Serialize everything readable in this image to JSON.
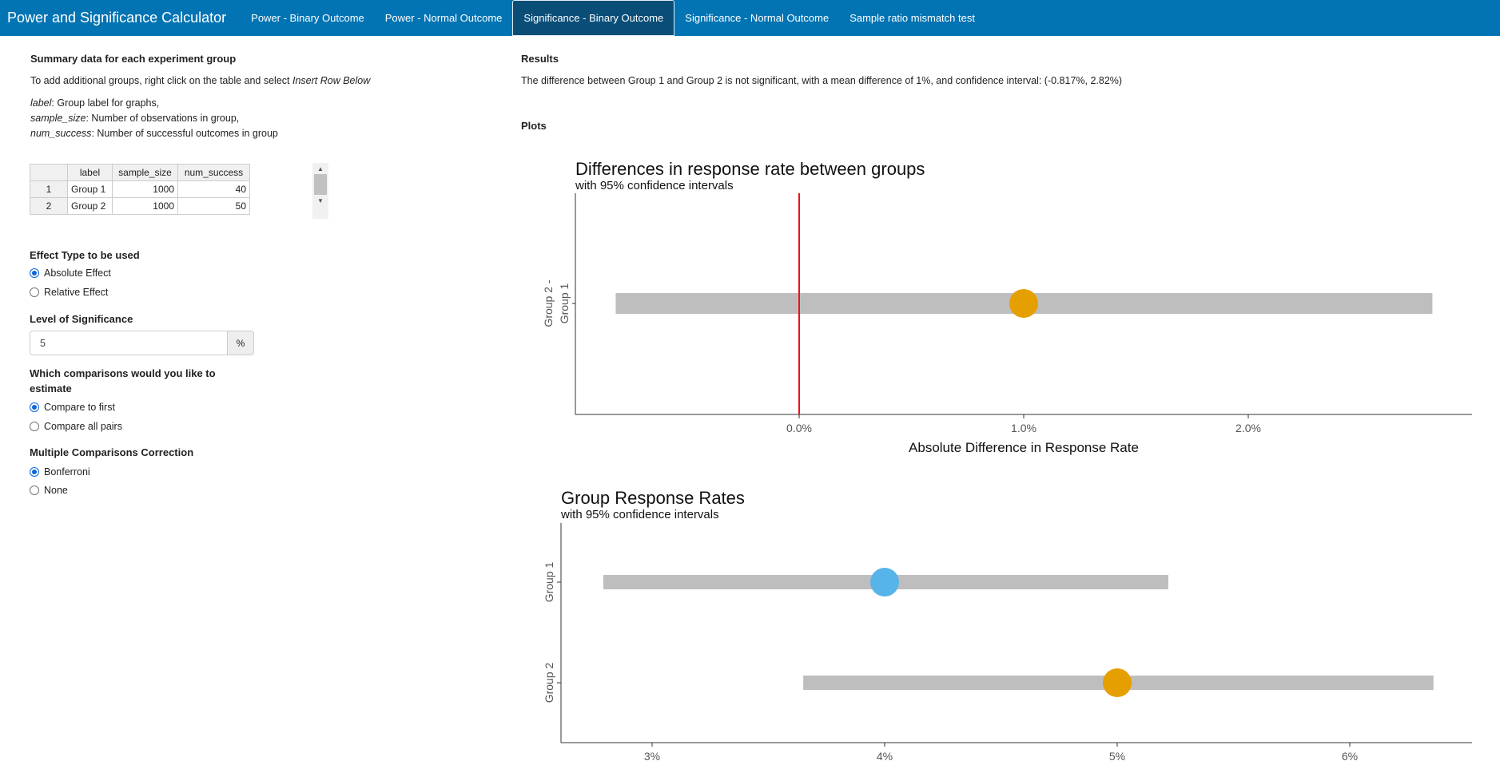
{
  "navbar": {
    "brand": "Power and Significance Calculator",
    "tabs": [
      {
        "label": "Power - Binary Outcome"
      },
      {
        "label": "Power - Normal Outcome"
      },
      {
        "label": "Significance - Binary Outcome",
        "active": true
      },
      {
        "label": "Significance - Normal Outcome"
      },
      {
        "label": "Sample ratio mismatch test"
      }
    ]
  },
  "left": {
    "summary_heading": "Summary data for each experiment group",
    "add_groups_prefix": "To add additional groups, right click on the table and select ",
    "add_groups_italic": "Insert Row Below",
    "desc": [
      {
        "key": "label",
        "text": ": Group label for graphs,"
      },
      {
        "key": "sample_size",
        "text": ": Number of observations in group,"
      },
      {
        "key": "num_success",
        "text": ": Number of successful outcomes in group"
      }
    ],
    "table": {
      "headers": [
        "",
        "label",
        "sample_size",
        "num_success"
      ],
      "rows": [
        {
          "index": "1",
          "label": "Group 1",
          "sample_size": "1000",
          "num_success": "40"
        },
        {
          "index": "2",
          "label": "Group 2",
          "sample_size": "1000",
          "num_success": "50"
        }
      ]
    },
    "effect_type": {
      "label": "Effect Type to be used",
      "options": [
        {
          "label": "Absolute Effect",
          "checked": true
        },
        {
          "label": "Relative Effect",
          "checked": false
        }
      ]
    },
    "significance": {
      "label": "Level of Significance",
      "value": "5",
      "addon": "%"
    },
    "comparisons": {
      "label_line1": "Which comparisons would you like to",
      "label_line2": "estimate",
      "options": [
        {
          "label": "Compare to first",
          "checked": true
        },
        {
          "label": "Compare all pairs",
          "checked": false
        }
      ]
    },
    "correction": {
      "label": "Multiple Comparisons Correction",
      "options": [
        {
          "label": "Bonferroni",
          "checked": true
        },
        {
          "label": "None",
          "checked": false
        }
      ]
    }
  },
  "right": {
    "results_heading": "Results",
    "results_text": "The difference between Group 1 and Group 2 is not significant, with a mean difference of 1%, and confidence interval: (-0.817%, 2.82%)",
    "plots_heading": "Plots"
  },
  "colors": {
    "navbar": "#0274b3",
    "active_tab": "#0a4e78",
    "ci_bar": "#bebebe",
    "orange": "#e69f00",
    "blue": "#56b4e9",
    "zero_line": "#e8141c"
  },
  "chart_data": [
    {
      "type": "scatter",
      "title": "Differences in response rate between groups",
      "subtitle": "with 95% confidence intervals",
      "xlabel": "Absolute Difference in Response Rate",
      "ylabel": "",
      "xlim": [
        -1.0,
        3.0
      ],
      "x_ticks": [
        "0.0%",
        "1.0%",
        "2.0%"
      ],
      "x_tick_values": [
        0,
        1,
        2
      ],
      "reference_line": 0,
      "categories": [
        "Group 2 -\nGroup 1"
      ],
      "series": [
        {
          "estimate": [
            1.0
          ],
          "ci_low": [
            -0.817
          ],
          "ci_high": [
            2.82
          ],
          "color": "#e69f00"
        }
      ]
    },
    {
      "type": "scatter",
      "title": "Group Response Rates",
      "subtitle": "with 95% confidence intervals",
      "xlabel": "",
      "ylabel": "",
      "xlim": [
        2.6,
        6.5
      ],
      "x_ticks": [
        "3%",
        "4%",
        "5%",
        "6%"
      ],
      "x_tick_values": [
        3,
        4,
        5,
        6
      ],
      "categories": [
        "Group 1",
        "Group 2"
      ],
      "series": [
        {
          "estimate": [
            4.0,
            5.0
          ],
          "ci_low": [
            2.79,
            3.65
          ],
          "ci_high": [
            5.22,
            6.36
          ],
          "color": [
            "#56b4e9",
            "#e69f00"
          ]
        }
      ]
    }
  ]
}
